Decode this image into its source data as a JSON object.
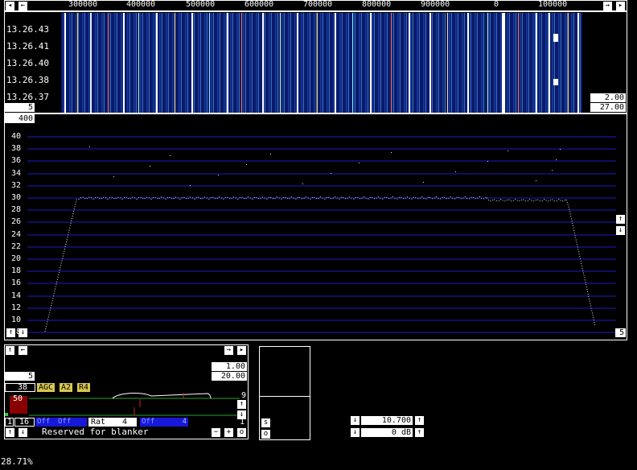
{
  "freq_scale": [
    "300000",
    "400000",
    "500000",
    "600000",
    "700000",
    "800000",
    "900000",
    "0",
    "100000"
  ],
  "waterfall_times": [
    "13.26.43",
    "13.26.41",
    "13.26.40",
    "13.26.38",
    "13.26.37"
  ],
  "waterfall_left_value": "5",
  "waterfall_right_top": "2.00",
  "waterfall_right_bottom": "27.00",
  "spectrum_top_value": "400",
  "spectrum_yticks": [
    "40",
    "38",
    "36",
    "34",
    "32",
    "30",
    "28",
    "26",
    "24",
    "22",
    "20",
    "18",
    "16",
    "14",
    "12",
    "10",
    "8"
  ],
  "spectrum_right_value": "5",
  "bottom": {
    "val_5": "5",
    "val_1_00": "1.00",
    "val_20_00": "20.00",
    "val_38": "38",
    "agc": "AGC",
    "a2": "A2",
    "r4": "R4",
    "val_50": "50",
    "val_9": "9",
    "val_1": "1",
    "num_1": "1",
    "num_16": "16",
    "off1": "Off",
    "off2": "Off",
    "rat_label": "Rat",
    "rat_value": "4",
    "off3": "Off",
    "val_4": "4",
    "reserved": "Reserved for blanker",
    "minus": "−",
    "plus": "+",
    "o": "o",
    "s": "s",
    "o2": "o",
    "freq_val": "10.700",
    "db_val": "0 dB"
  },
  "status": "28.71%",
  "colors": {
    "grid": "#1c1cc8",
    "panel_bg": "#000000",
    "white": "#ffffff",
    "agc_yellow": "#d8c850"
  }
}
